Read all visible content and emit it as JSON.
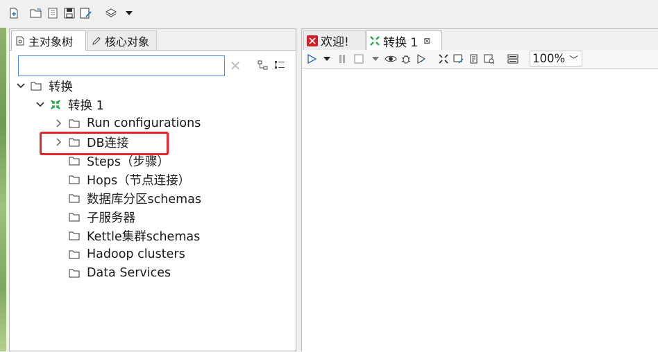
{
  "left_panel": {
    "tabs": [
      {
        "label": "主对象树",
        "icon": "document-icon"
      },
      {
        "label": "核心对象",
        "icon": "pencil-icon"
      }
    ],
    "search": {
      "value": "",
      "placeholder": ""
    }
  },
  "tree": {
    "root": {
      "label": "转换"
    },
    "transform": {
      "label": "转换 1"
    },
    "children": [
      {
        "label": "Run configurations",
        "has_children": true
      },
      {
        "label": "DB连接",
        "has_children": true,
        "highlighted": true
      },
      {
        "label": "Steps（步骤）",
        "has_children": false
      },
      {
        "label": "Hops（节点连接）",
        "has_children": false
      },
      {
        "label": "数据库分区schemas",
        "has_children": false
      },
      {
        "label": "子服务器",
        "has_children": false
      },
      {
        "label": "Kettle集群schemas",
        "has_children": false
      },
      {
        "label": "Hadoop clusters",
        "has_children": false
      },
      {
        "label": "Data Services",
        "has_children": false
      }
    ]
  },
  "right_panel": {
    "tabs": [
      {
        "label": "欢迎!",
        "icon": "spoon-logo-icon"
      },
      {
        "label": "转换 1",
        "icon": "transformation-icon",
        "closable": true
      }
    ],
    "zoom": {
      "value": "100%"
    }
  },
  "colors": {
    "highlight": "#e8242b",
    "transform_icon": "#2aa84a",
    "focus_border": "#4b8fd6"
  }
}
